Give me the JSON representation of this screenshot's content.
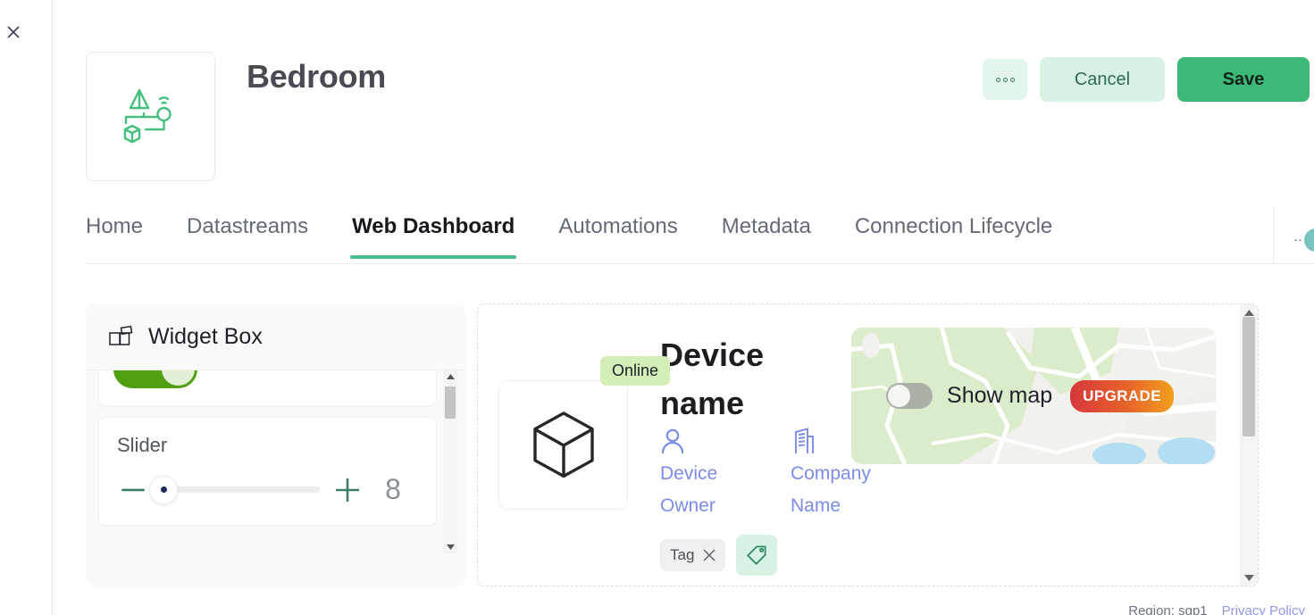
{
  "window": {
    "close_label": "×"
  },
  "header": {
    "title": "Bedroom",
    "thumb_icon": "iot-device-icon",
    "more_label": "",
    "cancel_label": "Cancel",
    "save_label": "Save"
  },
  "tabs": {
    "items": [
      {
        "label": "Home",
        "active": false
      },
      {
        "label": "Datastreams",
        "active": false
      },
      {
        "label": "Web Dashboard",
        "active": true
      },
      {
        "label": "Automations",
        "active": false
      },
      {
        "label": "Metadata",
        "active": false
      },
      {
        "label": "Connection Lifecycle",
        "active": false
      }
    ],
    "overflow_label": "...",
    "info_label": "i"
  },
  "widget_box": {
    "title": "Widget Box",
    "icon": "widgets-icon",
    "widgets": [
      {
        "type": "switch",
        "label": "",
        "value": "on"
      },
      {
        "type": "slider",
        "label": "Slider",
        "value": "8"
      }
    ],
    "slider_minus": "−",
    "slider_plus": "+"
  },
  "device": {
    "name": "Device name",
    "status": "Online",
    "owner_label": "Device Owner",
    "company_label": "Company Name",
    "owner_icon": "person-icon",
    "company_icon": "building-icon",
    "placeholder_icon": "cube-icon",
    "tags": [
      {
        "label": "Tag",
        "remove": "×"
      }
    ],
    "add_tag_icon": "tag-icon"
  },
  "map": {
    "toggle_label": "Show map",
    "toggle_state": "off",
    "upgrade_label": "UPGRADE"
  },
  "footer": {
    "region": "Region: sgp1",
    "privacy": "Privacy Policy"
  },
  "colors": {
    "accent_green": "#3cb878",
    "light_green": "#d8f2e3",
    "tab_underline": "#4cbd8a",
    "online_badge": "#d5edb6",
    "meta_blue": "#7b8ce8",
    "switch_green": "#4f9f10",
    "info_teal": "#79c4c1"
  }
}
